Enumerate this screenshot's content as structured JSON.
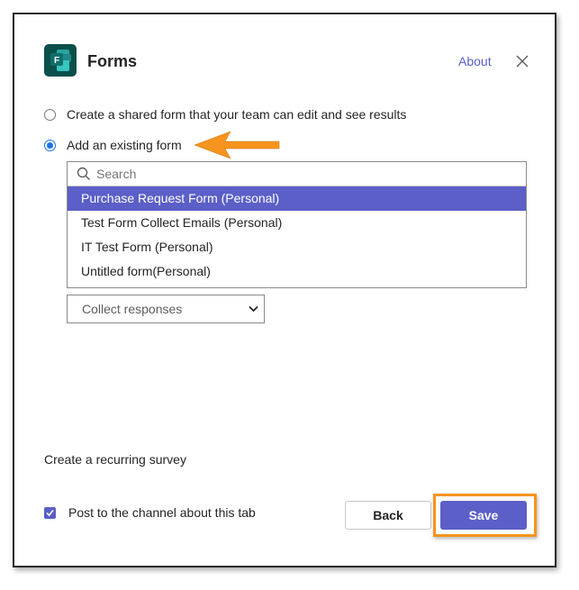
{
  "header": {
    "app_title": "Forms",
    "about_link": "About",
    "icon": "forms-app-icon",
    "close_icon": "close-icon"
  },
  "options": {
    "create_shared": "Create a shared form that your team can edit and see results",
    "add_existing": "Add an existing form",
    "selected": "add_existing"
  },
  "form_list": {
    "search_placeholder": "Search",
    "items": [
      "Purchase Request Form (Personal)",
      "Test Form Collect Emails (Personal)",
      "IT Test Form (Personal)",
      "Untitled form(Personal)"
    ],
    "selected_index": 0
  },
  "mode_select": {
    "value": "Collect responses"
  },
  "recurring_survey_label": "Create a recurring survey",
  "post_to_channel": {
    "label": "Post to the channel about this tab",
    "checked": true
  },
  "buttons": {
    "back": "Back",
    "save": "Save"
  },
  "colors": {
    "accent": "#5b5fc7",
    "highlight": "#f7941d",
    "forms_icon_bg": "#0b4f4b"
  }
}
